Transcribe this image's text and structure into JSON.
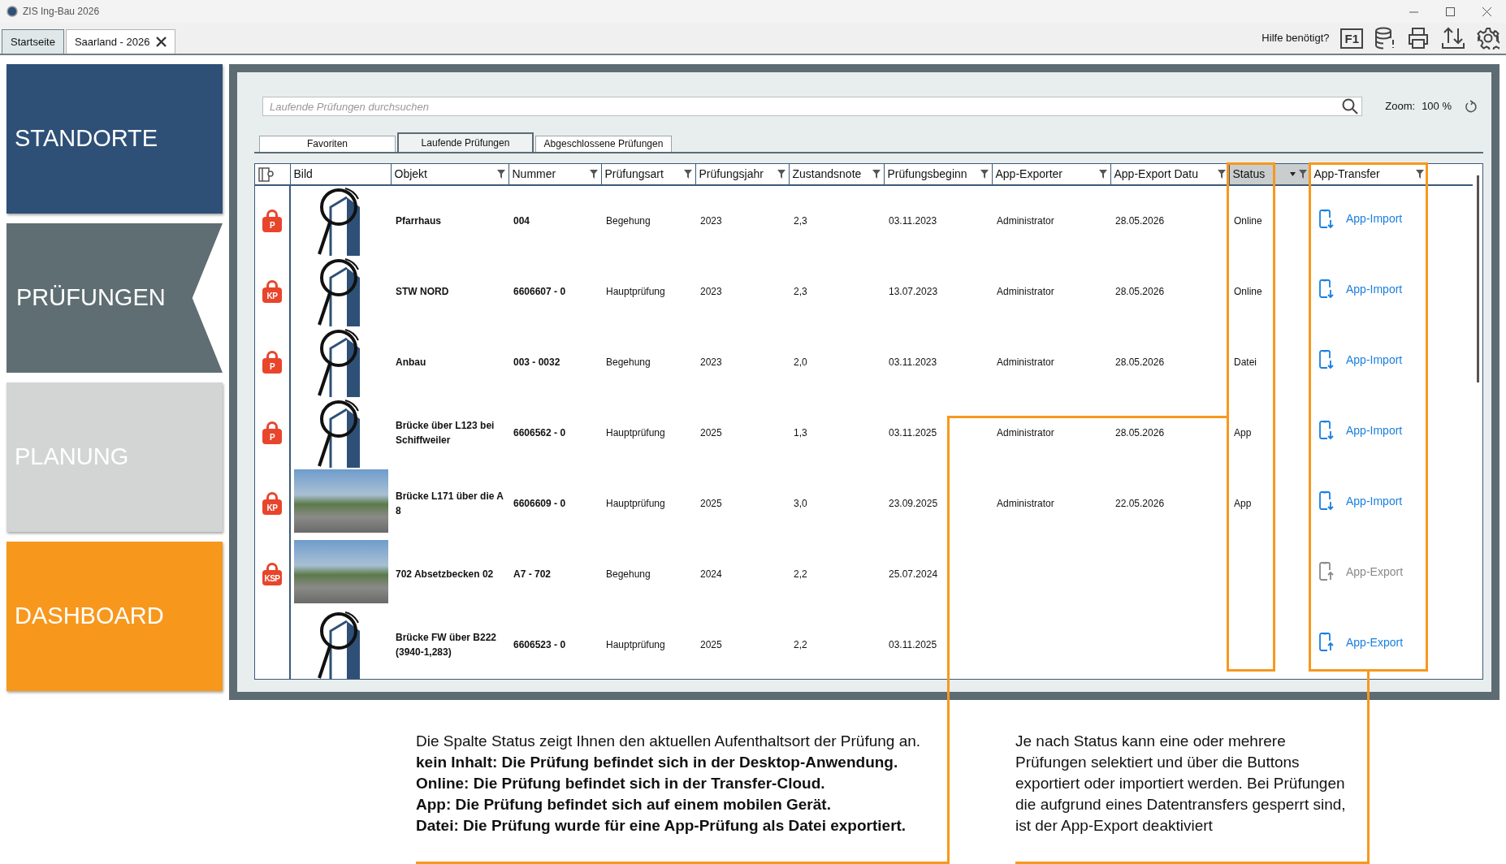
{
  "window": {
    "title": "ZIS Ing-Bau 2026"
  },
  "doc_tabs": [
    {
      "label": "Startseite",
      "selected": true,
      "closable": false
    },
    {
      "label": "Saarland - 2026",
      "selected": false,
      "closable": true
    }
  ],
  "toolbar": {
    "help_label": "Hilfe benötigt?",
    "help_key": "F1"
  },
  "sidebar": [
    {
      "label": "STANDORTE",
      "color": "#2e5077",
      "selected": false
    },
    {
      "label": "PRÜFUNGEN",
      "color": "#5f6e72",
      "selected": true
    },
    {
      "label": "PLANUNG",
      "color": "#d3d5d5",
      "selected": false
    },
    {
      "label": "DASHBOARD",
      "color": "#f7981d",
      "selected": false
    }
  ],
  "search": {
    "placeholder": "Laufende Prüfungen durchsuchen"
  },
  "zoom": {
    "label": "Zoom:",
    "value": "100 %"
  },
  "view_tabs": [
    {
      "label": "Favoriten",
      "selected": false
    },
    {
      "label": "Laufende Prüfungen",
      "selected": true
    },
    {
      "label": "Abgeschlossene Prüfungen",
      "selected": false
    }
  ],
  "table": {
    "columns": [
      {
        "label": "Bild"
      },
      {
        "label": "Objekt",
        "filter": true
      },
      {
        "label": "Nummer",
        "filter": true
      },
      {
        "label": "Prüfungsart",
        "filter": true
      },
      {
        "label": "Prüfungsjahr",
        "filter": true
      },
      {
        "label": "Zustandsnote",
        "filter": true
      },
      {
        "label": "Prüfungsbeginn",
        "filter": true
      },
      {
        "label": "App-Exporter",
        "filter": true
      },
      {
        "label": "App-Export Datu",
        "filter": true
      },
      {
        "label": "Status",
        "filter": true,
        "sorted": true
      },
      {
        "label": "App-Transfer",
        "filter": true
      }
    ],
    "rows": [
      {
        "lock": "P",
        "kind": "drawing",
        "objekt": "Pfarrhaus",
        "nummer": "004",
        "art": "Begehung",
        "jahr": "2023",
        "note": "2,3",
        "beginn": "03.11.2023",
        "exporter": "Administrator",
        "export_datum": "28.05.2026",
        "status": "Online",
        "transfer": {
          "label": "App-Import",
          "kind": "import",
          "disabled": false
        }
      },
      {
        "lock": "KP",
        "kind": "drawing",
        "objekt": "STW NORD",
        "nummer": "6606607 - 0",
        "art": "Hauptprüfung",
        "jahr": "2023",
        "note": "2,3",
        "beginn": "13.07.2023",
        "exporter": "Administrator",
        "export_datum": "28.05.2026",
        "status": "Online",
        "transfer": {
          "label": "App-Import",
          "kind": "import",
          "disabled": false
        }
      },
      {
        "lock": "P",
        "kind": "drawing",
        "objekt": "Anbau",
        "nummer": "003 - 0032",
        "art": "Begehung",
        "jahr": "2023",
        "note": "2,0",
        "beginn": "03.11.2023",
        "exporter": "Administrator",
        "export_datum": "28.05.2026",
        "status": "Datei",
        "transfer": {
          "label": "App-Import",
          "kind": "import",
          "disabled": false
        }
      },
      {
        "lock": "P",
        "kind": "drawing",
        "objekt": "Brücke über L123 bei Schiffweiler",
        "nummer": "6606562 - 0",
        "art": "Hauptprüfung",
        "jahr": "2025",
        "note": "1,3",
        "beginn": "03.11.2025",
        "exporter": "Administrator",
        "export_datum": "28.05.2026",
        "status": "App",
        "transfer": {
          "label": "App-Import",
          "kind": "import",
          "disabled": false
        }
      },
      {
        "lock": "KP",
        "kind": "photo",
        "objekt": "Brücke L171 über die A 8",
        "nummer": "6606609 - 0",
        "art": "Hauptprüfung",
        "jahr": "2025",
        "note": "3,0",
        "beginn": "23.09.2025",
        "exporter": "Administrator",
        "export_datum": "22.05.2026",
        "status": "App",
        "transfer": {
          "label": "App-Import",
          "kind": "import",
          "disabled": false
        }
      },
      {
        "lock": "KSP",
        "kind": "photo",
        "objekt": "702 Absetzbecken 02",
        "nummer": "A7 - 702",
        "art": "Begehung",
        "jahr": "2024",
        "note": "2,2",
        "beginn": "25.07.2024",
        "transfer": {
          "label": "App-Export",
          "kind": "export",
          "disabled": true
        }
      },
      {
        "kind": "drawing",
        "objekt": "Brücke FW über B222 (3940-1,283)",
        "nummer": "6606523 - 0",
        "art": "Hauptprüfung",
        "jahr": "2025",
        "note": "2,2",
        "beginn": "03.11.2025",
        "transfer": {
          "label": "App-Export",
          "kind": "export",
          "disabled": false
        }
      }
    ]
  },
  "notes": [
    {
      "lines": [
        {
          "text": "Die Spalte Status zeigt Ihnen den aktuellen Aufenthaltsort der Prüfung an.",
          "bold": false
        },
        {
          "text": "kein Inhalt: Die Prüfung befindet sich in der Desktop-Anwendung.",
          "bold": true
        },
        {
          "text": "Online: Die Prüfung befindet sich in der Transfer-Cloud.",
          "bold": true
        },
        {
          "text": "App: Die Prüfung befindet sich auf einem mobilen Gerät.",
          "bold": true
        },
        {
          "text": "Datei: Die Prüfung wurde für eine App-Prüfung als Datei exportiert.",
          "bold": true
        }
      ]
    },
    {
      "lines": [
        {
          "text": "Je nach Status kann eine oder mehrere Prüfungen selektiert und über die Buttons exportiert oder importiert werden. Bei Prüfungen die aufgrund eines Datentransfers gesperrt sind, ist der App-Export deaktiviert",
          "bold": false
        }
      ]
    }
  ]
}
